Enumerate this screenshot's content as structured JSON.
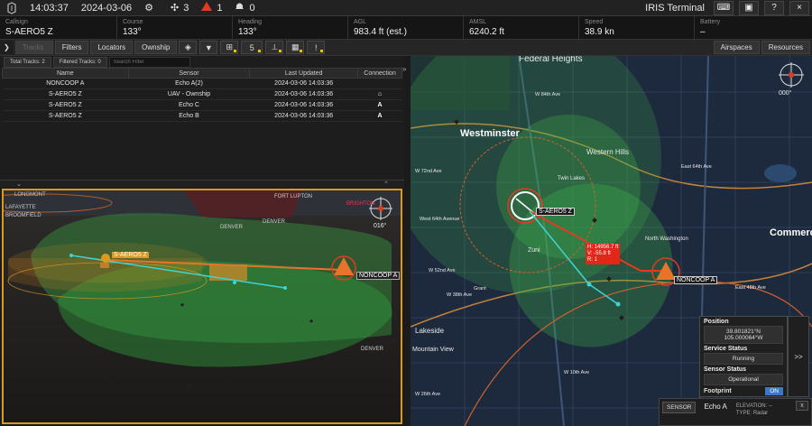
{
  "topbar": {
    "time": "14:03:37",
    "date": "2024-03-06",
    "drone_count": "3",
    "alert_count": "1",
    "notification_count": "0",
    "app_title": "IRIS Terminal",
    "buttons": [
      "keyboard-icon",
      "screenshot-icon",
      "help-icon",
      "close-icon"
    ],
    "help_label": "?",
    "close_label": "×"
  },
  "status": [
    {
      "label": "Callsign",
      "value": "S-AERO5 Z"
    },
    {
      "label": "Course",
      "value": "133°"
    },
    {
      "label": "Heading",
      "value": "133°"
    },
    {
      "label": "AGL",
      "value": "983.4 ft (est.)"
    },
    {
      "label": "AMSL",
      "value": "6240.2 ft"
    },
    {
      "label": "Speed",
      "value": "38.9 kn"
    },
    {
      "label": "Battery",
      "value": "–"
    }
  ],
  "toolbar": {
    "tracks_label": "Tracks",
    "filters_label": "Filters",
    "locators_label": "Locators",
    "ownship_label": "Ownship",
    "slot_label": "5",
    "airspaces_label": "Airspaces",
    "resources_label": "Resources"
  },
  "trackpanel": {
    "total_tracks": "Total Tracks: 2",
    "filtered_tracks": "Filtered Tracks: 0",
    "search_placeholder": "Search Filter",
    "columns": [
      "Name",
      "Sensor",
      "Last Updated",
      "Connection"
    ],
    "rows": [
      {
        "name": "NONCOOP A",
        "sensor": "Echo A(2)",
        "updated": "2024-03-06 14:03:36",
        "conn": ""
      },
      {
        "name": "S-AERO5 Z",
        "sensor": "UAV - Ownship",
        "updated": "2024-03-06 14:03:36",
        "conn": "⌂"
      },
      {
        "name": "S-AERO5 Z",
        "sensor": "Echo C",
        "updated": "2024-03-06 14:03:36",
        "conn": "A"
      },
      {
        "name": "S-AERO5 Z",
        "sensor": "Echo B",
        "updated": "2024-03-06 14:03:36",
        "conn": "A"
      }
    ]
  },
  "view3d": {
    "compass_heading": "016°",
    "labels": {
      "longmont": "LONGMONT",
      "lafayette": "LAFAYETTE",
      "broomfield": "BROOMFIELD",
      "fort_lupton": "FORT LUPTON",
      "brighton": "BRIGHTON",
      "denver1": "DENVER",
      "denver2": "DENVER",
      "denver3": "DENVER",
      "ownship": "S-AERO5 Z",
      "noncoop": "NONCOOP A"
    }
  },
  "map": {
    "compass_heading": "000°",
    "places": {
      "federal_heights": "Federal Heights",
      "westminster": "Westminster",
      "western_hills": "Western Hills",
      "twin_lakes": "Twin Lakes",
      "commerce": "Commerce",
      "north_washington": "North Washington",
      "zuni": "Zuni",
      "lakeside": "Lakeside",
      "mountain_view": "Mountain View",
      "w84": "W 84th Ave",
      "w72": "W 72nd Ave",
      "w64": "West 64th Avenue",
      "w52": "W 52nd Ave",
      "w38": "W 38th Ave",
      "w26": "W 26th Ave",
      "w10": "W 10th Ave",
      "e64": "East 64th Ave",
      "e48": "East 48th Ave",
      "grant": "Grant"
    },
    "ownship_label": "S-AERO5 Z",
    "noncoop_label": "NONCOOP A",
    "measure": {
      "h": "H: 14956.7 ft",
      "v": "V: -55.8 ft",
      "r": "R: 1"
    }
  },
  "sensorpanel": {
    "position_label": "Position",
    "position_value": "39.801821°N 105.000064°W",
    "service_label": "Service Status",
    "service_value": "Running",
    "sensor_label": "Sensor Status",
    "sensor_value": "Operational",
    "footprint_label": "Footprint",
    "footprint_value": "ON",
    "expand": ">>"
  },
  "bottombar": {
    "sensor_btn": "SENSOR",
    "name": "Echo A",
    "elevation": "ELEVATION: --",
    "type": "TYPE: Radar",
    "close": "x"
  },
  "colors": {
    "accent_orange": "#d99a1e",
    "alert_red": "#e23b1f",
    "footprint_green": "#3fb64a",
    "track_cyan": "#3fd3d8",
    "footprint_on": "#3a78c8"
  }
}
